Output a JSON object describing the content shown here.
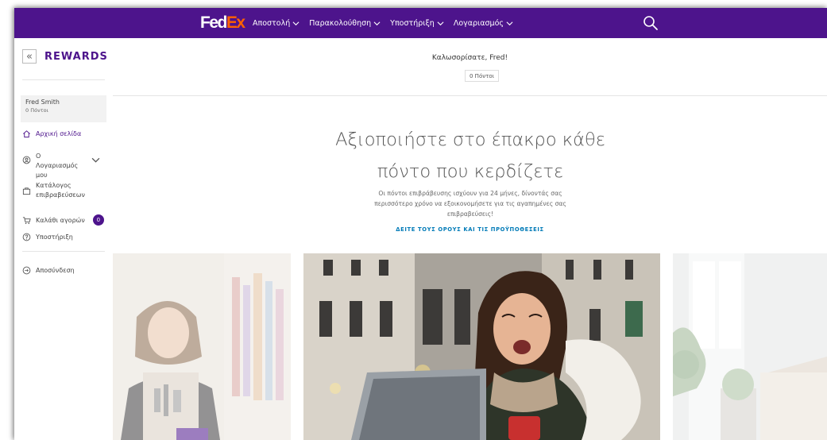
{
  "header": {
    "logo_fed": "Fed",
    "logo_ex": "Ex",
    "nav": [
      {
        "label": "Αποστολή"
      },
      {
        "label": "Παρακολούθηση"
      },
      {
        "label": "Υποστήριξη"
      },
      {
        "label": "Λογαριασμός"
      }
    ]
  },
  "sidebar": {
    "collapse_glyph": "«",
    "title": "REWARDS",
    "user_name": "Fred Smith",
    "user_points": "0 Πόντοι",
    "items": [
      {
        "label": "Αρχική σελίδα",
        "icon": "home-icon"
      },
      {
        "label": "Ο Λογαριασμός μου",
        "icon": "account-icon"
      },
      {
        "label": "Κατάλογος επιβραβεύσεων",
        "icon": "catalog-icon"
      },
      {
        "label": "Καλάθι αγορών",
        "icon": "cart-icon",
        "badge": "0"
      },
      {
        "label": "Υποστήριξη",
        "icon": "help-icon"
      },
      {
        "label": "Αποσύνδεση",
        "icon": "logout-icon"
      }
    ]
  },
  "main": {
    "welcome": "Καλωσορίσατε, Fred!",
    "points": "0 Πόντοι",
    "headline_1": "Αξιοποιήστε στο έπακρο κάθε",
    "headline_2": "πόντο που κερδίζετε",
    "subtext": "Οι πόντοι επιβράβευσης ισχύουν για 24 μήνες, δίνοντάς σας περισσότερο χρόνο να εξοικονομήσετε για τις αγαπημένες σας επιβραβεύσεις!",
    "terms_link": "ΔΕΙΤΕ ΤΟΥΣ ΟΡΟΥΣ ΚΑΙ ΤΙΣ ΠΡΟΫΠΟΘΕΣΕΙΣ"
  },
  "colors": {
    "brand_purple": "#4d148c",
    "brand_orange": "#ff6200",
    "link_blue": "#007ab7"
  }
}
